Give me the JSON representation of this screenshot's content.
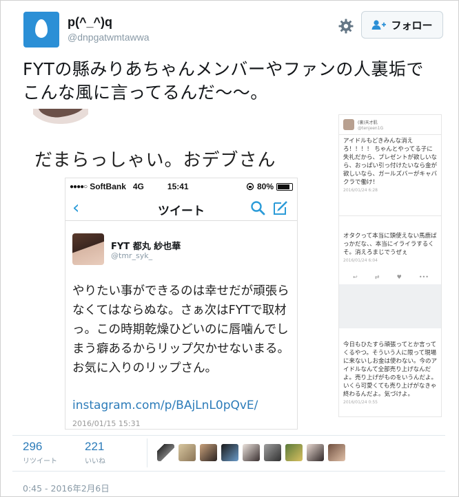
{
  "user": {
    "display_name": "p(^_^)q",
    "handle": "@dnpgatwmtawwa"
  },
  "follow_button": {
    "label": "フォロー"
  },
  "tweet": {
    "text": "FYTの縣みりあちゃんメンバーやファンの人裏垢でこんな風に言ってるんだ〜〜。"
  },
  "image": {
    "caption": "だまらっしゃい。おデブさん",
    "status_bar": {
      "dots": "●●●●○",
      "carrier": "SoftBank",
      "network": "4G",
      "time": "15:41",
      "battery": "80%"
    },
    "nav_title": "ツイート",
    "inner_tweet": {
      "name": "FYT 都丸 紗也華",
      "handle": "@tmr_syk_",
      "body": "やりたい事ができるのは幸せだが頑張らなくてはならぬな。さぁ次はFYTで取材っ。この時期乾燥ひどいのに唇噛んでしまう癖あるからリップ欠かせないまる。お気に入りのリップさん。",
      "link": "instagram.com/p/BAjLnL0pQvE/",
      "date": "2016/01/15 15:31"
    },
    "right_screenshot": {
      "name": "(裏)天才肌",
      "handle": "@tenjeen1G",
      "posts": [
        {
          "text": "アイドルもどきみんな消え ろ！！！！ ちゃんとやってる子に失礼だから、プレゼントが欲しいなら、おっぱい引っ付けたいなら金が欲しいなら、ガールズバーがキャバクラで働け！",
          "date": "2016/01/24 6:28"
        },
        {
          "text": "オタクって本当に頭使えない馬鹿ばっかだな、、本当にイライラするくそ。消えろまじでうぜぇ",
          "date": "2016/01/24 6:04"
        },
        {
          "text": "今日もひたすら頑張ってとか言ってくるやつ。そういう人に限って現場に来ないしお金は使わない。今のアイドルなんて全部売り上げなんだよ。売り上げがものをいうんだよ。いくら可愛くても売り上げがなきゃ終わるんだよ。気づけよ。",
          "date": "2016/01/24 0:55"
        }
      ]
    }
  },
  "stats": {
    "retweets": {
      "count": "296",
      "label": "リツイート"
    },
    "likes": {
      "count": "221",
      "label": "いいね"
    }
  },
  "timestamp": "0:45 - 2016年2月6日",
  "colors": {
    "accent": "#2b7bb9",
    "avatar_bg": "#2b8fd6",
    "muted": "#8899a6"
  }
}
